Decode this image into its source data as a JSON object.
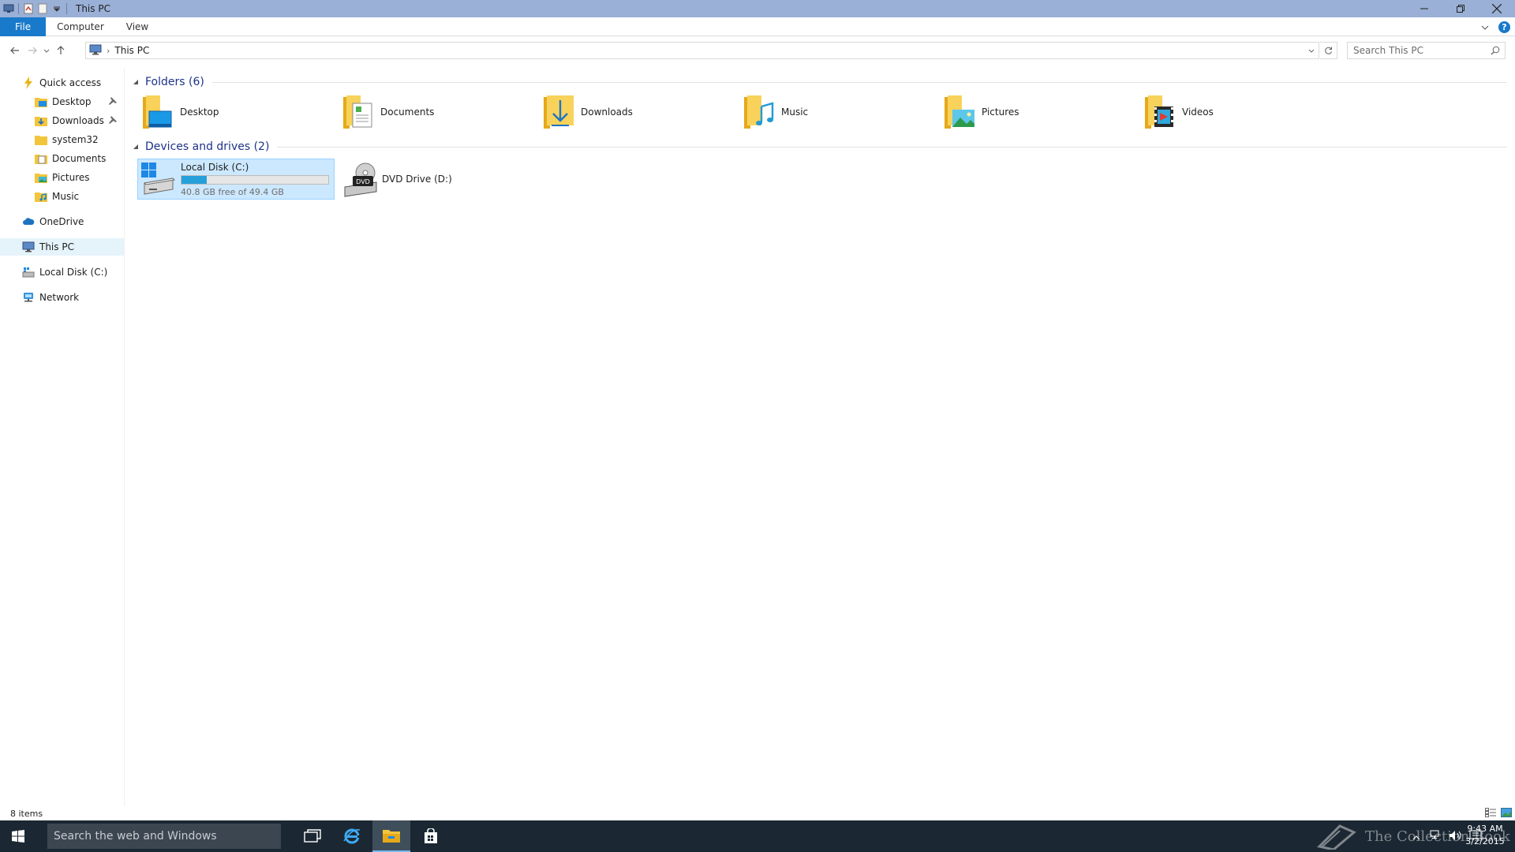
{
  "window": {
    "title": "This PC"
  },
  "ribbon": {
    "tabs": [
      "File",
      "Computer",
      "View"
    ]
  },
  "address": {
    "crumb": "This PC",
    "search_placeholder": "Search This PC"
  },
  "nav": {
    "quick_access": "Quick access",
    "qa_items": [
      {
        "label": "Desktop",
        "pinned": true
      },
      {
        "label": "Downloads",
        "pinned": true
      },
      {
        "label": "system32",
        "pinned": false
      },
      {
        "label": "Documents",
        "pinned": false
      },
      {
        "label": "Pictures",
        "pinned": false
      },
      {
        "label": "Music",
        "pinned": false
      }
    ],
    "onedrive": "OneDrive",
    "thispc": "This PC",
    "localdisk": "Local Disk (C:)",
    "network": "Network"
  },
  "content": {
    "folders_header": "Folders (6)",
    "folders": [
      "Desktop",
      "Documents",
      "Downloads",
      "Music",
      "Pictures",
      "Videos"
    ],
    "devices_header": "Devices and drives (2)",
    "drive_c": {
      "name": "Local Disk (C:)",
      "free_text": "40.8 GB free of 49.4 GB",
      "used_fraction": 0.174
    },
    "drive_d": {
      "name": "DVD Drive (D:)",
      "badge": "DVD"
    }
  },
  "status": {
    "count": "8 items"
  },
  "taskbar": {
    "search_placeholder": "Search the web and Windows",
    "watermark": "The Collection Book",
    "time": "9:43 AM",
    "date": "3/2/2015"
  },
  "colors": {
    "accent": "#1979ca",
    "selection": "#cce8ff",
    "taskbar": "#1b2833",
    "titlebar": "#9ab0d6",
    "drivebar": "#26a0da"
  }
}
